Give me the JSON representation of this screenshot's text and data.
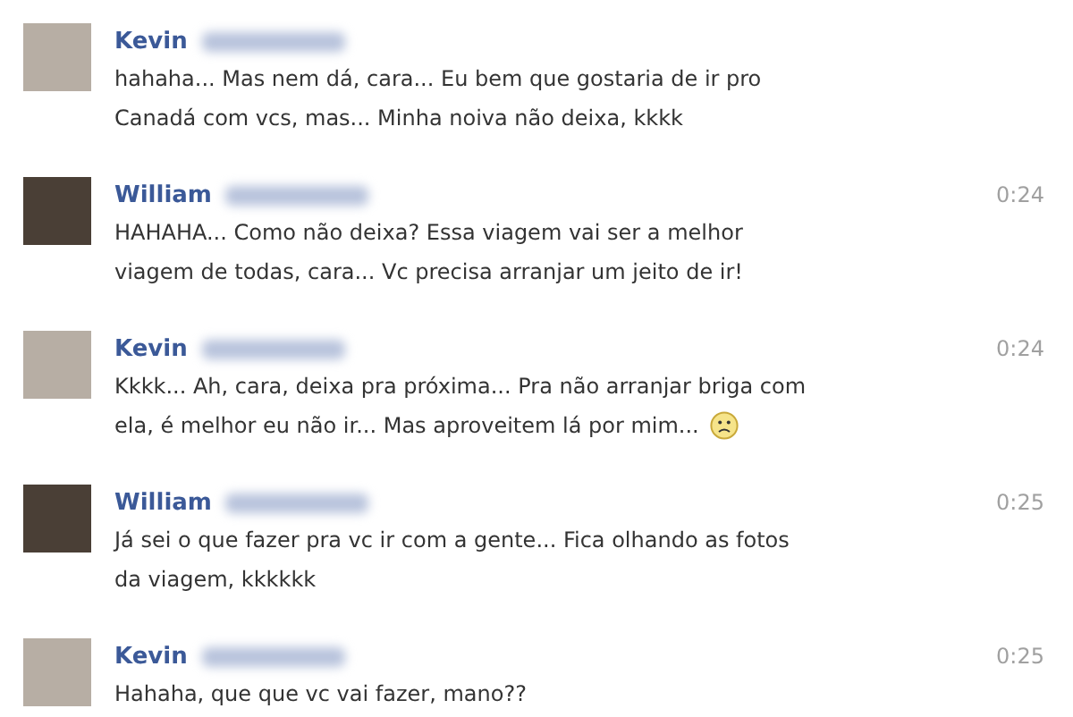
{
  "messages": [
    {
      "sender": "Kevin",
      "surname_hidden": true,
      "color": "#b7aea4",
      "lines": [
        "hahaha... Mas nem dá, cara... Eu bem que gostaria de ir pro",
        "Canadá com vcs, mas... Minha noiva não deixa, kkkk"
      ],
      "sad_emoticon": false
    },
    {
      "sender": "William",
      "surname_hidden": true,
      "color": "#4a3f36",
      "time": "0:24",
      "lines": [
        "HAHAHA... Como não deixa? Essa viagem vai ser a melhor",
        "viagem de todas, cara... Vc precisa arranjar um jeito de ir!"
      ],
      "sad_emoticon": false
    },
    {
      "sender": "Kevin",
      "surname_hidden": true,
      "color": "#b7aea4",
      "time": "0:24",
      "lines": [
        "Kkkk... Ah, cara, deixa pra próxima... Pra não arranjar briga com",
        "ela, é melhor eu não ir... Mas aproveitem lá por mim..."
      ],
      "sad_emoticon": true
    },
    {
      "sender": "William",
      "surname_hidden": true,
      "color": "#4a3f36",
      "time": "0:25",
      "lines": [
        "Já sei o que fazer pra vc ir com a gente... Fica olhando as fotos",
        "da viagem, kkkkkk"
      ],
      "sad_emoticon": false
    },
    {
      "sender": "Kevin",
      "surname_hidden": true,
      "color": "#b7aea4",
      "time": "0:25",
      "lines": [
        "Hahaha, que que vc vai fazer, mano??"
      ],
      "sad_emoticon": false
    }
  ]
}
